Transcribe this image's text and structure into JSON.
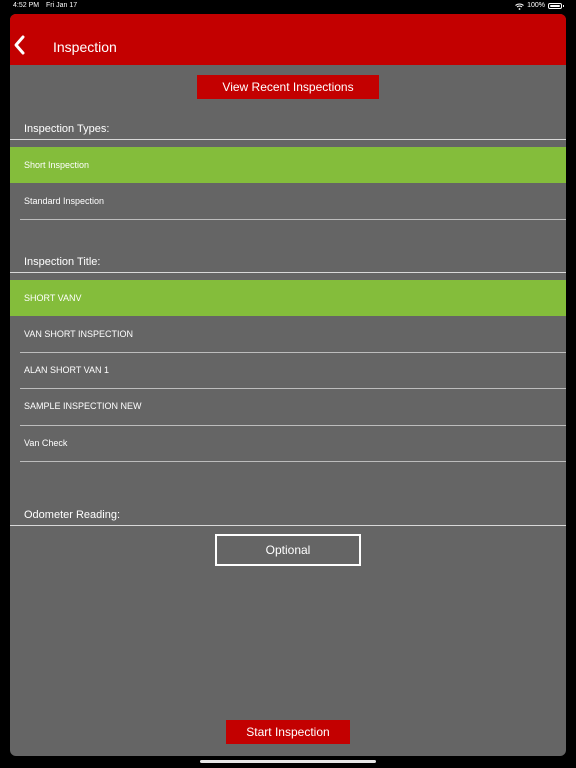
{
  "status_bar": {
    "time": "4:52 PM",
    "date": "Fri Jan 17",
    "battery": "100%",
    "icons": [
      "wifi-icon",
      "battery-icon"
    ]
  },
  "header": {
    "title": "Inspection",
    "back_icon": "chevron-left-icon",
    "background": "#c30000"
  },
  "recent_button": {
    "label": "View Recent Inspections"
  },
  "inspection_types": {
    "label": "Inspection Types:",
    "items": [
      {
        "label": "Short Inspection",
        "selected": true
      },
      {
        "label": "Standard Inspection",
        "selected": false
      }
    ]
  },
  "inspection_title": {
    "label": "Inspection Title:",
    "items": [
      {
        "label": "SHORT VANV",
        "selected": true
      },
      {
        "label": "VAN SHORT INSPECTION",
        "selected": false
      },
      {
        "label": "ALAN SHORT VAN 1",
        "selected": false
      },
      {
        "label": "SAMPLE INSPECTION NEW",
        "selected": false
      },
      {
        "label": "Van Check",
        "selected": false
      }
    ]
  },
  "odometer": {
    "label": "Odometer Reading:",
    "placeholder": "Optional"
  },
  "start_button": {
    "label": "Start Inspection"
  },
  "colors": {
    "accent": "#c30000",
    "selected": "#84bd3b",
    "panel": "#656565"
  }
}
